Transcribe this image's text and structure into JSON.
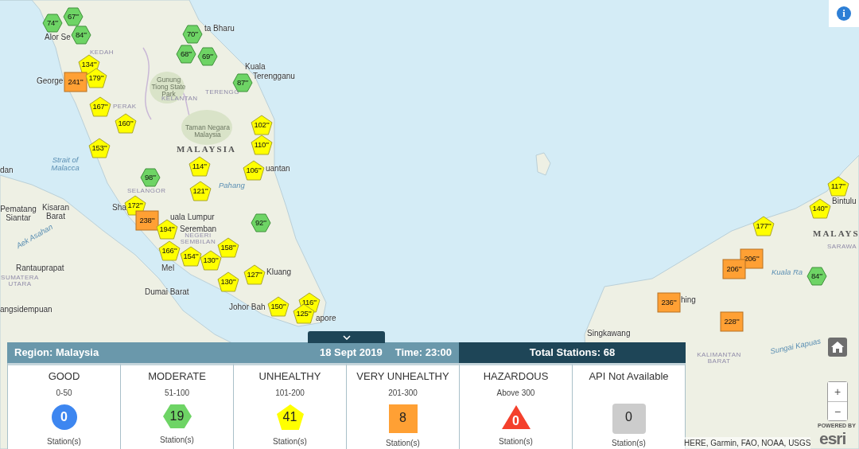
{
  "info_button": {
    "label": "i"
  },
  "markers": [
    {
      "kind": "moderate",
      "label": "74$^{**}$"
    },
    {
      "kind": "moderate",
      "label": "67$^{**}$"
    },
    {
      "kind": "moderate",
      "label": "84$^{**}$"
    },
    {
      "kind": "moderate",
      "label": "70$^{**}$"
    },
    {
      "kind": "moderate",
      "label": "68$^{**}$"
    },
    {
      "kind": "moderate",
      "label": "69$^{**}$"
    },
    {
      "kind": "moderate",
      "label": "87$^{**}$"
    },
    {
      "kind": "unhealthy",
      "label": "134$^{**}$"
    },
    {
      "kind": "very_unhealthy",
      "label": "241$^{**}$"
    },
    {
      "kind": "unhealthy",
      "label": "179$^{**}$"
    },
    {
      "kind": "unhealthy",
      "label": "167$^{**}$"
    },
    {
      "kind": "unhealthy",
      "label": "160$^{**}$"
    },
    {
      "kind": "unhealthy",
      "label": "153$^{**}$"
    },
    {
      "kind": "unhealthy",
      "label": "102$^{**}$"
    },
    {
      "kind": "unhealthy",
      "label": "110$^{**}$"
    },
    {
      "kind": "unhealthy",
      "label": "106$^{**}$"
    },
    {
      "kind": "unhealthy",
      "label": "114$^{**}$"
    },
    {
      "kind": "moderate",
      "label": "98$^{**}$"
    },
    {
      "kind": "unhealthy",
      "label": "121$^{**}$"
    },
    {
      "kind": "unhealthy",
      "label": "172$^{**}$"
    },
    {
      "kind": "very_unhealthy",
      "label": "238$^{**}$"
    },
    {
      "kind": "unhealthy",
      "label": "194$^{**}$"
    },
    {
      "kind": "moderate",
      "label": "92$^{**}$"
    },
    {
      "kind": "unhealthy",
      "label": "158$^{**}$"
    },
    {
      "kind": "unhealthy",
      "label": "166$^{**}$"
    },
    {
      "kind": "unhealthy",
      "label": "154$^{**}$"
    },
    {
      "kind": "unhealthy",
      "label": "130$^{**}$"
    },
    {
      "kind": "unhealthy",
      "label": "127$^{**}$"
    },
    {
      "kind": "unhealthy",
      "label": "130$^{**}$"
    },
    {
      "kind": "unhealthy",
      "label": "150$^{**}$"
    },
    {
      "kind": "unhealthy",
      "label": "116$^{**}$"
    },
    {
      "kind": "unhealthy",
      "label": "125$^{**}$"
    },
    {
      "kind": "unhealthy",
      "label": "117$^{**}$"
    },
    {
      "kind": "unhealthy",
      "label": "140$^{**}$"
    },
    {
      "kind": "unhealthy",
      "label": "177$^{**}$"
    },
    {
      "kind": "very_unhealthy",
      "label": "206$^{**}$"
    },
    {
      "kind": "very_unhealthy",
      "label": "206$^{**}$"
    },
    {
      "kind": "moderate",
      "label": "84$^{**}$"
    },
    {
      "kind": "very_unhealthy",
      "label": "236$^{**}$"
    },
    {
      "kind": "very_unhealthy",
      "label": "228$^{**}$"
    }
  ],
  "map_labels": [
    {
      "kind": "city",
      "text": "Alor Se"
    },
    {
      "kind": "city",
      "text": "ta Bharu"
    },
    {
      "kind": "region",
      "text": "KEDAH"
    },
    {
      "kind": "city",
      "text": "Kuala"
    },
    {
      "kind": "city",
      "text": "Terengganu"
    },
    {
      "kind": "city",
      "text": "George"
    },
    {
      "kind": "park",
      "text": "Gunung Tiong State Park"
    },
    {
      "kind": "region",
      "text": "KELANTAN"
    },
    {
      "kind": "region",
      "text": "TERENGG"
    },
    {
      "kind": "region",
      "text": "PERAK"
    },
    {
      "kind": "park",
      "text": "Taman Negara Malaysia"
    },
    {
      "kind": "country",
      "text": "MALAYSIA"
    },
    {
      "kind": "city",
      "text": "dan"
    },
    {
      "kind": "water",
      "text": "Strait of Malacca"
    },
    {
      "kind": "region",
      "text": "SELANGOR"
    },
    {
      "kind": "water",
      "text": "Pahang"
    },
    {
      "kind": "city",
      "text": "uantan"
    },
    {
      "kind": "city",
      "text": "Pematang Siantar"
    },
    {
      "kind": "city",
      "text": "Kisaran Barat"
    },
    {
      "kind": "city",
      "text": "Sha"
    },
    {
      "kind": "city",
      "text": "uala Lumpur"
    },
    {
      "kind": "city",
      "text": "Seremban"
    },
    {
      "kind": "region",
      "text": "NEGERI SEMBILAN"
    },
    {
      "kind": "water",
      "text": "Aek Asahan"
    },
    {
      "kind": "city",
      "text": "Rantauprapat"
    },
    {
      "kind": "region",
      "text": "SUMATERA UTARA"
    },
    {
      "kind": "city",
      "text": "Mel"
    },
    {
      "kind": "city",
      "text": "Kluang"
    },
    {
      "kind": "city",
      "text": "Dumai Barat"
    },
    {
      "kind": "city",
      "text": "angsidempuan"
    },
    {
      "kind": "city",
      "text": "Johor Bah"
    },
    {
      "kind": "city",
      "text": "apore"
    },
    {
      "kind": "city",
      "text": "Bintulu"
    },
    {
      "kind": "country",
      "text": "MALAYS"
    },
    {
      "kind": "region",
      "text": "SARAWA"
    },
    {
      "kind": "water",
      "text": "Kuala Ra"
    },
    {
      "kind": "city",
      "text": "hing"
    },
    {
      "kind": "city",
      "text": "Singkawang"
    },
    {
      "kind": "region",
      "text": "KALIMANTAN BARAT"
    },
    {
      "kind": "water",
      "text": "Sungai Kapuas"
    }
  ],
  "summary_bar": {
    "region": "Region: Malaysia",
    "date": "18 Sept 2019",
    "time": "Time: 23:00",
    "total": "Total Stations: 68"
  },
  "categories": [
    {
      "kind": "good",
      "title": "GOOD",
      "range": "0-50",
      "count": "0",
      "unit": "Station(s)"
    },
    {
      "kind": "moderate",
      "title": "MODERATE",
      "range": "51-100",
      "count": "19",
      "unit": "Station(s)"
    },
    {
      "kind": "unhealthy",
      "title": "UNHEALTHY",
      "range": "101-200",
      "count": "41",
      "unit": "Station(s)"
    },
    {
      "kind": "very_unhealthy",
      "title": "VERY UNHEALTHY",
      "range": "201-300",
      "count": "8",
      "unit": "Station(s)"
    },
    {
      "kind": "hazardous",
      "title": "HAZARDOUS",
      "range": "Above 300",
      "count": "0",
      "unit": "Station(s)"
    },
    {
      "kind": "not_available",
      "title": "API Not Available",
      "count": "0",
      "unit": "Station(s)"
    }
  ],
  "zoom": {
    "in": "+",
    "out": "−"
  },
  "attribution": "HERE, Garmin, FAO, NOAA, USGS",
  "logo": {
    "caption": "POWERED BY",
    "name": "esri"
  }
}
